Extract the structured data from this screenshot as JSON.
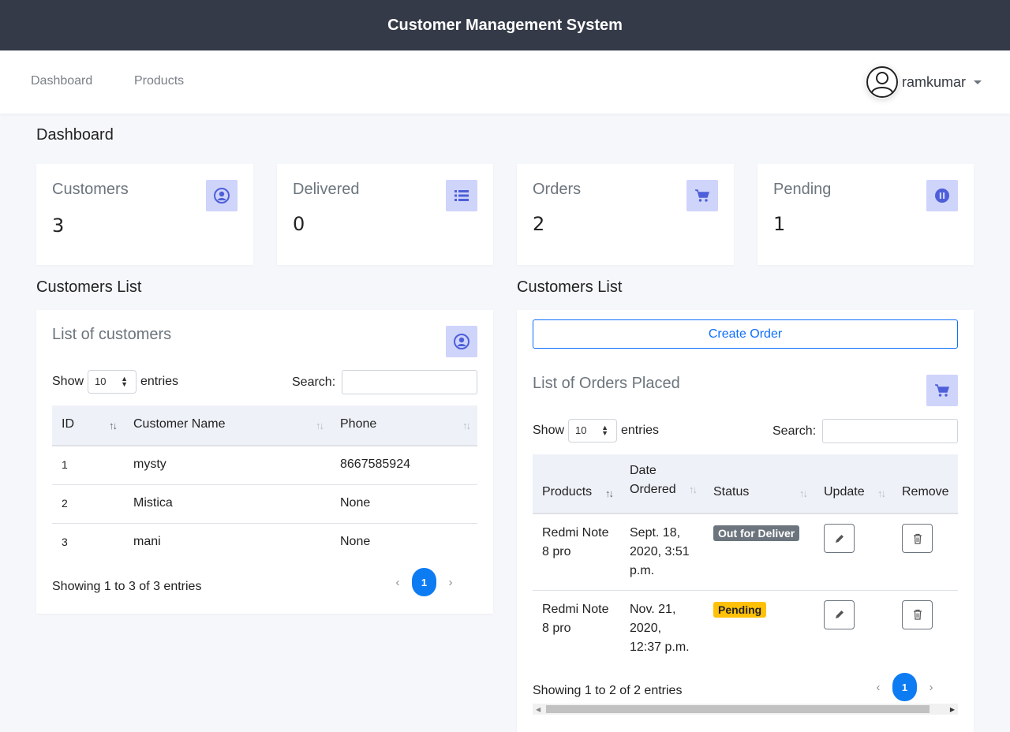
{
  "app": {
    "title": "Customer Management System"
  },
  "nav": {
    "links": [
      "Dashboard",
      "Products"
    ],
    "user": "ramkumar"
  },
  "page_title": "Dashboard",
  "stats": [
    {
      "label": "Customers",
      "value": "3",
      "icon": "user-circle-icon"
    },
    {
      "label": "Delivered",
      "value": "0",
      "icon": "list-icon"
    },
    {
      "label": "Orders",
      "value": "2",
      "icon": "cart-icon"
    },
    {
      "label": "Pending",
      "value": "1",
      "icon": "pause-circle-icon"
    }
  ],
  "customers": {
    "section_title": "Customers List",
    "card_title": "List of customers",
    "show_label": "Show",
    "entries_label": "entries",
    "page_size": "10",
    "search_label": "Search:",
    "columns": [
      "ID",
      "Customer Name",
      "Phone"
    ],
    "rows": [
      {
        "id": "1",
        "name": "mysty",
        "phone": "8667585924"
      },
      {
        "id": "2",
        "name": "Mistica",
        "phone": "None"
      },
      {
        "id": "3",
        "name": "mani",
        "phone": "None"
      }
    ],
    "info": "Showing 1 to 3 of 3 entries",
    "page": "1"
  },
  "orders": {
    "section_title": "Customers List",
    "create_button": "Create Order",
    "card_title": "List of Orders Placed",
    "show_label": "Show",
    "entries_label": "entries",
    "page_size": "10",
    "search_label": "Search:",
    "columns": [
      "Products",
      "Date Ordered",
      "Status",
      "Update",
      "Remove"
    ],
    "rows": [
      {
        "product": "Redmi Note 8 pro",
        "date": "Sept. 18, 2020, 3:51 p.m.",
        "status": "Out for Deliver",
        "status_color": "#6c757d"
      },
      {
        "product": "Redmi Note 8 pro",
        "date": "Nov. 21, 2020, 12:37 p.m.",
        "status": "Pending",
        "status_color": "#ffc107"
      }
    ],
    "info": "Showing 1 to 2 of 2 entries",
    "page": "1"
  },
  "colors": {
    "accent": "#0d7cf2",
    "icon_box": "#cfd4fb",
    "icon_fg": "#4e5fd9",
    "topbar": "#343a47"
  }
}
